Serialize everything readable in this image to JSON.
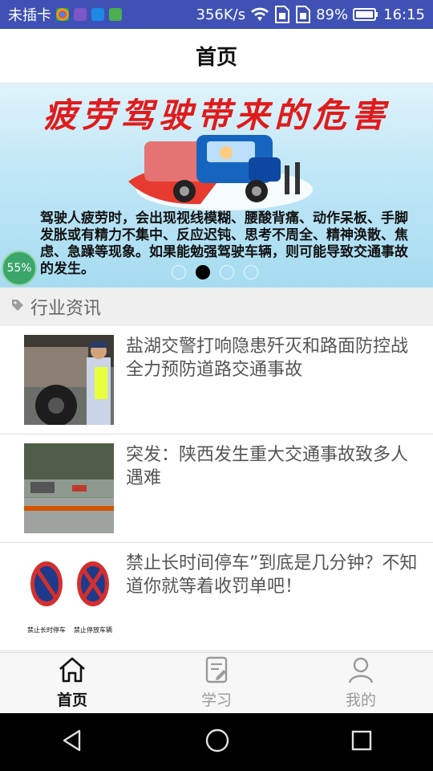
{
  "status_bar": {
    "carrier": "未插卡",
    "speed": "356K/s",
    "battery": "89%",
    "time": "16:15"
  },
  "header": {
    "title": "首页"
  },
  "banner": {
    "title": "疲劳驾驶带来的危害",
    "body": "驾驶人疲劳时，会出现视线模糊、腰酸背痛、动作呆板、手脚发胀或有精力不集中、反应迟钝、思考不周全、精神涣散、焦虑、急躁等现象。如果能勉强驾驶车辆，则可能导致交通事故的发生。",
    "badge": "55%",
    "slide_count": 4,
    "active_slide": 2
  },
  "section": {
    "label": "行业资讯",
    "icon": "tag-icon"
  },
  "news": [
    {
      "title": "盐湖交警打响隐患歼灭和路面防控战全力预防道路交通事故"
    },
    {
      "title": "突发：陕西发生重大交通事故致多人遇难"
    },
    {
      "title": "禁止长时间停车”到底是几分钟？不知道你就等着收罚单吧！",
      "sign_left": "禁止长时停车",
      "sign_right": "禁止停放车辆"
    }
  ],
  "tabs": [
    {
      "label": "首页",
      "icon": "home-icon",
      "active": true
    },
    {
      "label": "学习",
      "icon": "notebook-icon",
      "active": false
    },
    {
      "label": "我的",
      "icon": "profile-icon",
      "active": false
    }
  ],
  "colors": {
    "status_bar": "#3f51b5",
    "banner_title": "#e01b1b",
    "nav_bar": "#000000"
  }
}
